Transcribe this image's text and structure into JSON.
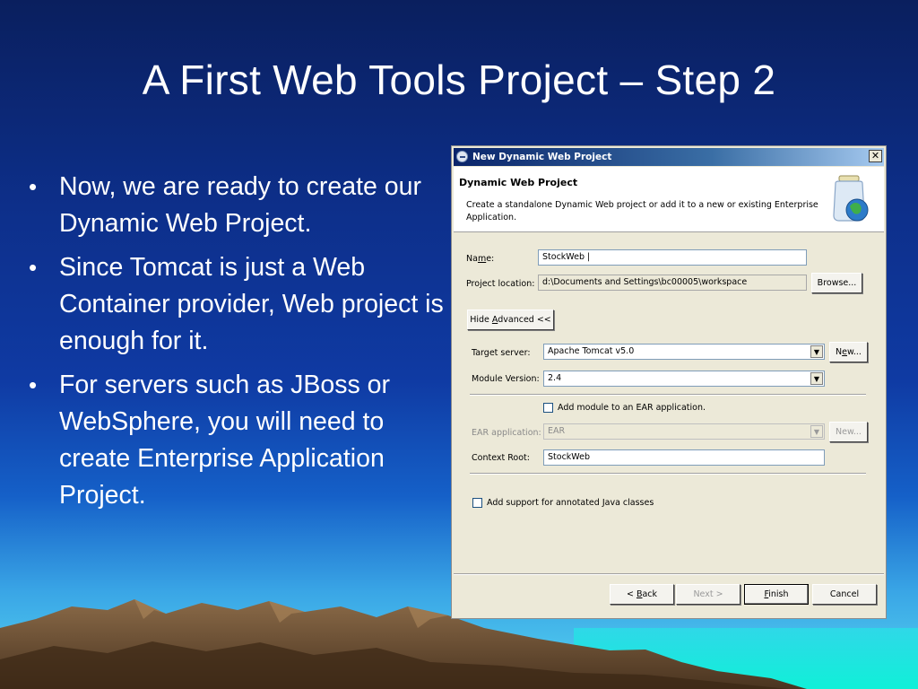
{
  "slide": {
    "title": "A First Web Tools Project – Step 2",
    "bullet_glyph": "•",
    "bullets": [
      "Now, we are ready to create our Dynamic Web Project.",
      "Since Tomcat is just a Web Container provider, Web project is enough for it.",
      "For servers such as JBoss or WebSphere, you will need to create Enterprise Application Project."
    ]
  },
  "dialog": {
    "window_title": "New Dynamic Web Project",
    "close_glyph": "✕",
    "banner_title": "Dynamic Web Project",
    "banner_desc": "Create a standalone Dynamic Web project or add it to a new or existing Enterprise Application.",
    "banner_icon": "jar-globe-icon",
    "name_label_pre": "Na",
    "name_label_mn": "m",
    "name_label_post": "e:",
    "name_value": "StockWeb |",
    "location_label": "Project location:",
    "location_value": "d:\\Documents and Settings\\bc00005\\workspace",
    "browse_label": "Browse...",
    "hide_advanced_pre": "Hide ",
    "hide_advanced_mn": "A",
    "hide_advanced_post": "dvanced <<",
    "target_server_label": "Target server:",
    "target_server_value": "Apache Tomcat v5.0",
    "new_label_pre": "N",
    "new_label_mn": "e",
    "new_label_post": "w...",
    "module_version_label": "Module Version:",
    "module_version_value": "2.4",
    "add_module_label": "Add module to an EAR application.",
    "ear_label": "EAR application:",
    "ear_value": "EAR",
    "ear_new_label": "New...",
    "context_root_label": "Context Root:",
    "context_root_value": "StockWeb",
    "annotated_label": "Add support for annotated Java classes",
    "combo_arrow_glyph": "▼",
    "back_pre": "< ",
    "back_mn": "B",
    "back_post": "ack",
    "next_label": "Next >",
    "finish_mn": "F",
    "finish_post": "inish",
    "cancel_label": "Cancel"
  },
  "colors": {
    "title_bar": "#0a246a",
    "dialog_bg": "#ece9d8",
    "slide_text": "#ffffff"
  }
}
